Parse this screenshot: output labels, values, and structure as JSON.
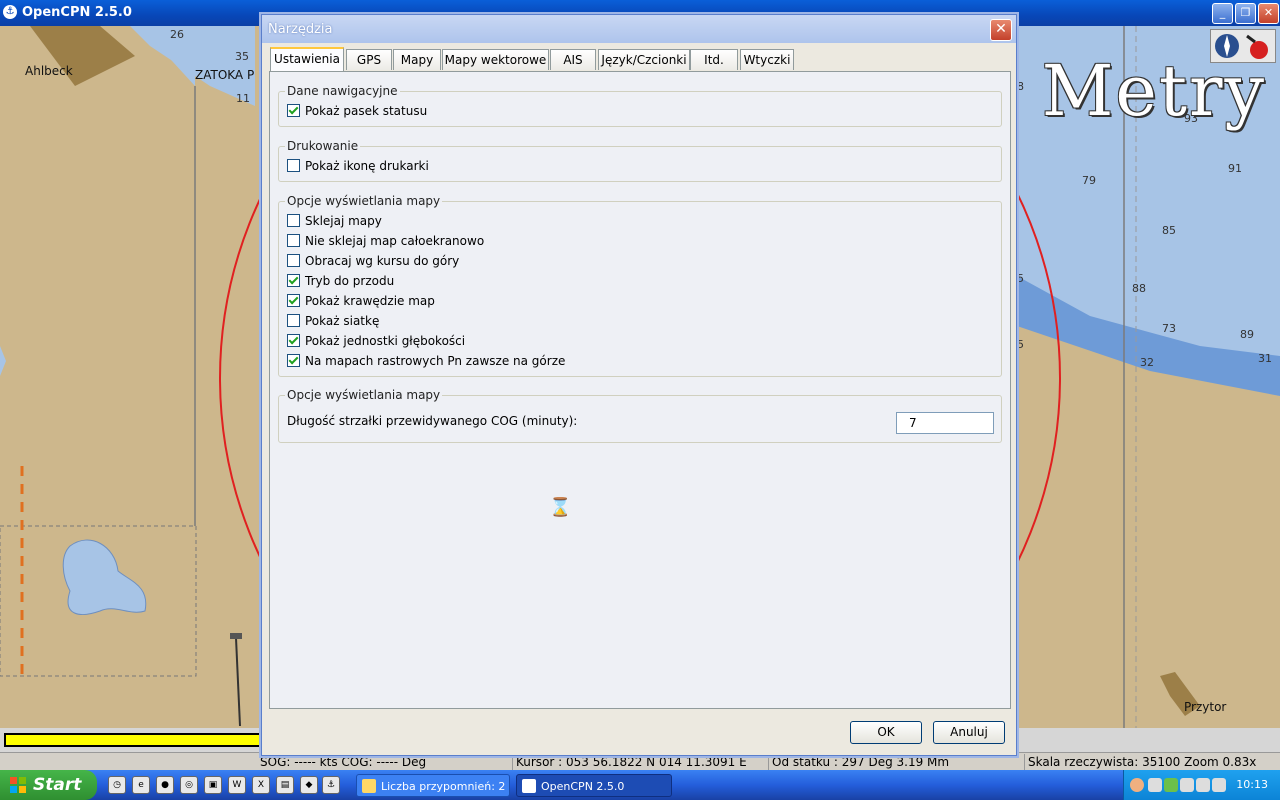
{
  "app": {
    "title": "OpenCPN 2.5.0"
  },
  "chart": {
    "unit_overlay": "Metry",
    "places": [
      "Ahlbeck",
      "ZATOKA P",
      "Przytor"
    ],
    "depths": [
      "26",
      "35",
      "11",
      "79",
      "91",
      "93",
      "85",
      "88",
      "73",
      "89",
      "31",
      "32",
      "5",
      "5",
      "8"
    ]
  },
  "dialog": {
    "title": "Narzędzia",
    "tabs": [
      "Ustawienia",
      "GPS",
      "Mapy",
      "Mapy wektorowe",
      "AIS",
      "Język/Czcionki",
      "Itd.",
      "Wtyczki"
    ],
    "active_tab": "Ustawienia",
    "groups": {
      "nav": {
        "label": "Dane nawigacyjne",
        "options": [
          {
            "label": "Pokaż pasek statusu",
            "checked": true
          }
        ]
      },
      "print": {
        "label": "Drukowanie",
        "options": [
          {
            "label": "Pokaż ikonę drukarki",
            "checked": false
          }
        ]
      },
      "display": {
        "label": "Opcje wyświetlania mapy",
        "options": [
          {
            "label": "Sklejaj mapy",
            "checked": false
          },
          {
            "label": "Nie sklejaj map całoekranowo",
            "checked": false
          },
          {
            "label": "Obracaj wg kursu do góry",
            "checked": false
          },
          {
            "label": "Tryb do przodu",
            "checked": true
          },
          {
            "label": "Pokaż krawędzie map",
            "checked": true
          },
          {
            "label": "Pokaż siatkę",
            "checked": false
          },
          {
            "label": "Pokaż jednostki głębokości",
            "checked": true
          },
          {
            "label": "Na mapach rastrowych Pn zawsze na górze",
            "checked": true
          }
        ]
      },
      "display2": {
        "label": "Opcje wyświetlania mapy",
        "cog_label": "Długość strzałki przewidywanego COG (minuty):",
        "cog_value": "7"
      }
    },
    "ok_label": "OK",
    "cancel_label": "Anuluj"
  },
  "statusbar": {
    "sog_cog": "SOG: ----- kts  COG: ----- Deg",
    "cursor": "Kursor :  053 56.1822 N 014 11.3091 E",
    "from_ship": "Od statku :  297 Deg    3.19 Mm",
    "scale": "Skala rzeczywista:    35100  Zoom 0.83x"
  },
  "taskbar": {
    "start_label": "Start",
    "tasks": [
      "Liczba przypomnień: 2",
      "OpenCPN 2.5.0"
    ],
    "clock": "10:13"
  }
}
